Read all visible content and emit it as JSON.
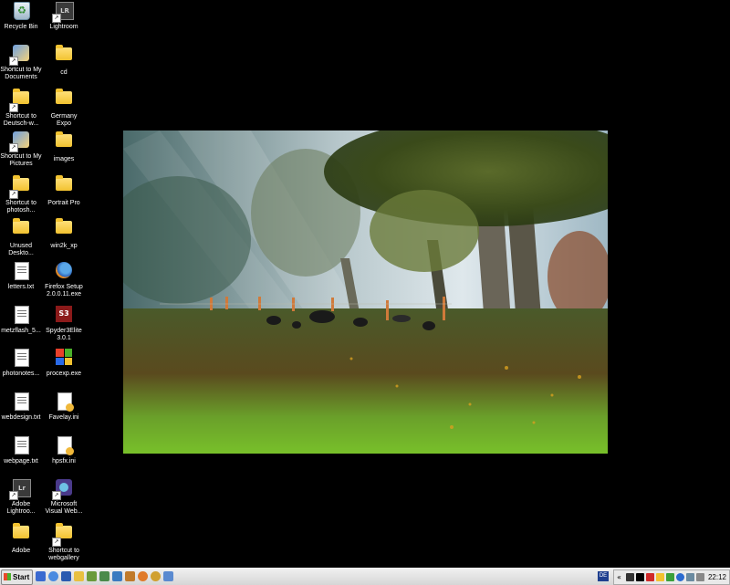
{
  "desktop": {
    "icons": [
      {
        "label": "Recycle Bin",
        "icon": "recycle-bin-icon"
      },
      {
        "label": "Lightroom",
        "icon": "lightroom-icon"
      },
      {
        "label": "Shortcut to My Documents",
        "icon": "my-documents-icon"
      },
      {
        "label": "cd",
        "icon": "folder-icon"
      },
      {
        "label": "Shortcut to Deutsch-w...",
        "icon": "folder-icon"
      },
      {
        "label": "Germany Expo",
        "icon": "folder-icon"
      },
      {
        "label": "Shortcut to My Pictures",
        "icon": "my-pictures-icon"
      },
      {
        "label": "images",
        "icon": "folder-icon"
      },
      {
        "label": "Shortcut to photosh...",
        "icon": "folder-icon"
      },
      {
        "label": "Portrait Pro",
        "icon": "folder-icon"
      },
      {
        "label": "Unused Deskto...",
        "icon": "folder-icon"
      },
      {
        "label": "win2k_xp",
        "icon": "folder-icon"
      },
      {
        "label": "letters.txt",
        "icon": "text-file-icon"
      },
      {
        "label": "Firefox Setup 2.0.0.11.exe",
        "icon": "firefox-setup-icon"
      },
      {
        "label": "metzflash_5...",
        "icon": "text-file-icon"
      },
      {
        "label": "Spyder3Elite 3.0.1",
        "icon": "spyder-icon"
      },
      {
        "label": "photonotes...",
        "icon": "text-file-icon"
      },
      {
        "label": "procexp.exe",
        "icon": "process-explorer-icon"
      },
      {
        "label": "webdesign.txt",
        "icon": "text-file-icon"
      },
      {
        "label": "Favelay.ini",
        "icon": "ini-file-icon"
      },
      {
        "label": "webpage.txt",
        "icon": "text-file-icon"
      },
      {
        "label": "hpsfx.ini",
        "icon": "ini-file-icon"
      },
      {
        "label": "Adobe Lightroo...",
        "icon": "lightroom-icon"
      },
      {
        "label": "Microsoft Visual Web...",
        "icon": "visual-web-icon"
      },
      {
        "label": "Adobe",
        "icon": "folder-icon"
      },
      {
        "label": "Shortcut to webgallery",
        "icon": "folder-icon"
      }
    ]
  },
  "taskbar": {
    "start_label": "Start",
    "language": "DE",
    "clock": "22:12"
  },
  "colors": {
    "desktop_bg": "#000000",
    "taskbar_bg": "#e0e0e0"
  }
}
